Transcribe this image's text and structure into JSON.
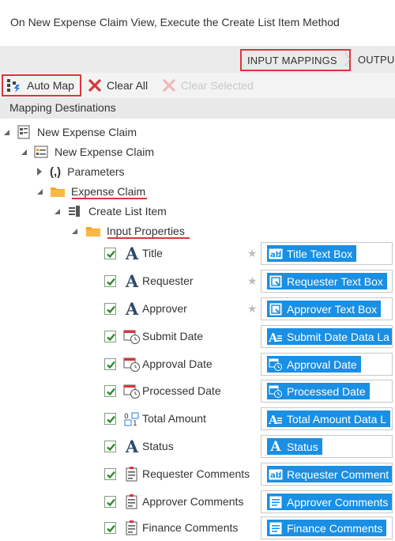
{
  "header": {
    "title": "On New Expense Claim View, Execute the Create List Item Method"
  },
  "tabs": {
    "input_mappings": "INPUT MAPPINGS",
    "output": "OUTPU"
  },
  "toolbar": {
    "auto_map": "Auto Map",
    "clear_all": "Clear All",
    "clear_selected": "Clear Selected"
  },
  "destinations": {
    "header": "Mapping Destinations",
    "tree": {
      "root": "New Expense Claim",
      "view": "New Expense Claim",
      "parameters": "Parameters",
      "expense_claim": "Expense Claim",
      "method": "Create List Item",
      "input_properties": "Input Properties"
    },
    "properties": [
      {
        "name": "Title",
        "icon": "text-a-icon",
        "starred": true,
        "target": "Title Text Box",
        "target_icon": "textbox-icon"
      },
      {
        "name": "Requester",
        "icon": "text-a-icon",
        "starred": true,
        "target": "Requester Text Box",
        "target_icon": "picker-icon"
      },
      {
        "name": "Approver",
        "icon": "text-a-icon",
        "starred": true,
        "target": "Approver Text Box",
        "target_icon": "picker-icon"
      },
      {
        "name": "Submit Date",
        "icon": "datetime-icon",
        "starred": false,
        "target": "Submit Date Data La",
        "target_icon": "data-label-icon"
      },
      {
        "name": "Approval Date",
        "icon": "datetime-icon",
        "starred": false,
        "target": "Approval Date",
        "target_icon": "datetime-icon"
      },
      {
        "name": "Processed Date",
        "icon": "datetime-icon",
        "starred": false,
        "target": "Processed Date",
        "target_icon": "datetime-icon"
      },
      {
        "name": "Total Amount",
        "icon": "number-icon",
        "starred": false,
        "target": "Total Amount Data L",
        "target_icon": "data-label-icon"
      },
      {
        "name": "Status",
        "icon": "text-a-icon",
        "starred": false,
        "target": "Status",
        "target_icon": "text-a-icon"
      },
      {
        "name": "Requester Comments",
        "icon": "memo-icon",
        "starred": false,
        "target": "Requester Comment",
        "target_icon": "textbox-icon"
      },
      {
        "name": "Approver Comments",
        "icon": "memo-icon",
        "starred": false,
        "target": "Approver Comments",
        "target_icon": "memo-icon"
      },
      {
        "name": "Finance Comments",
        "icon": "memo-icon",
        "starred": false,
        "target": "Finance Comments",
        "target_icon": "memo-icon"
      }
    ]
  },
  "colors": {
    "accent": "#1a8fe3",
    "highlight": "#e0343b",
    "check": "#3a9a3a",
    "folder": "#f5a623"
  }
}
